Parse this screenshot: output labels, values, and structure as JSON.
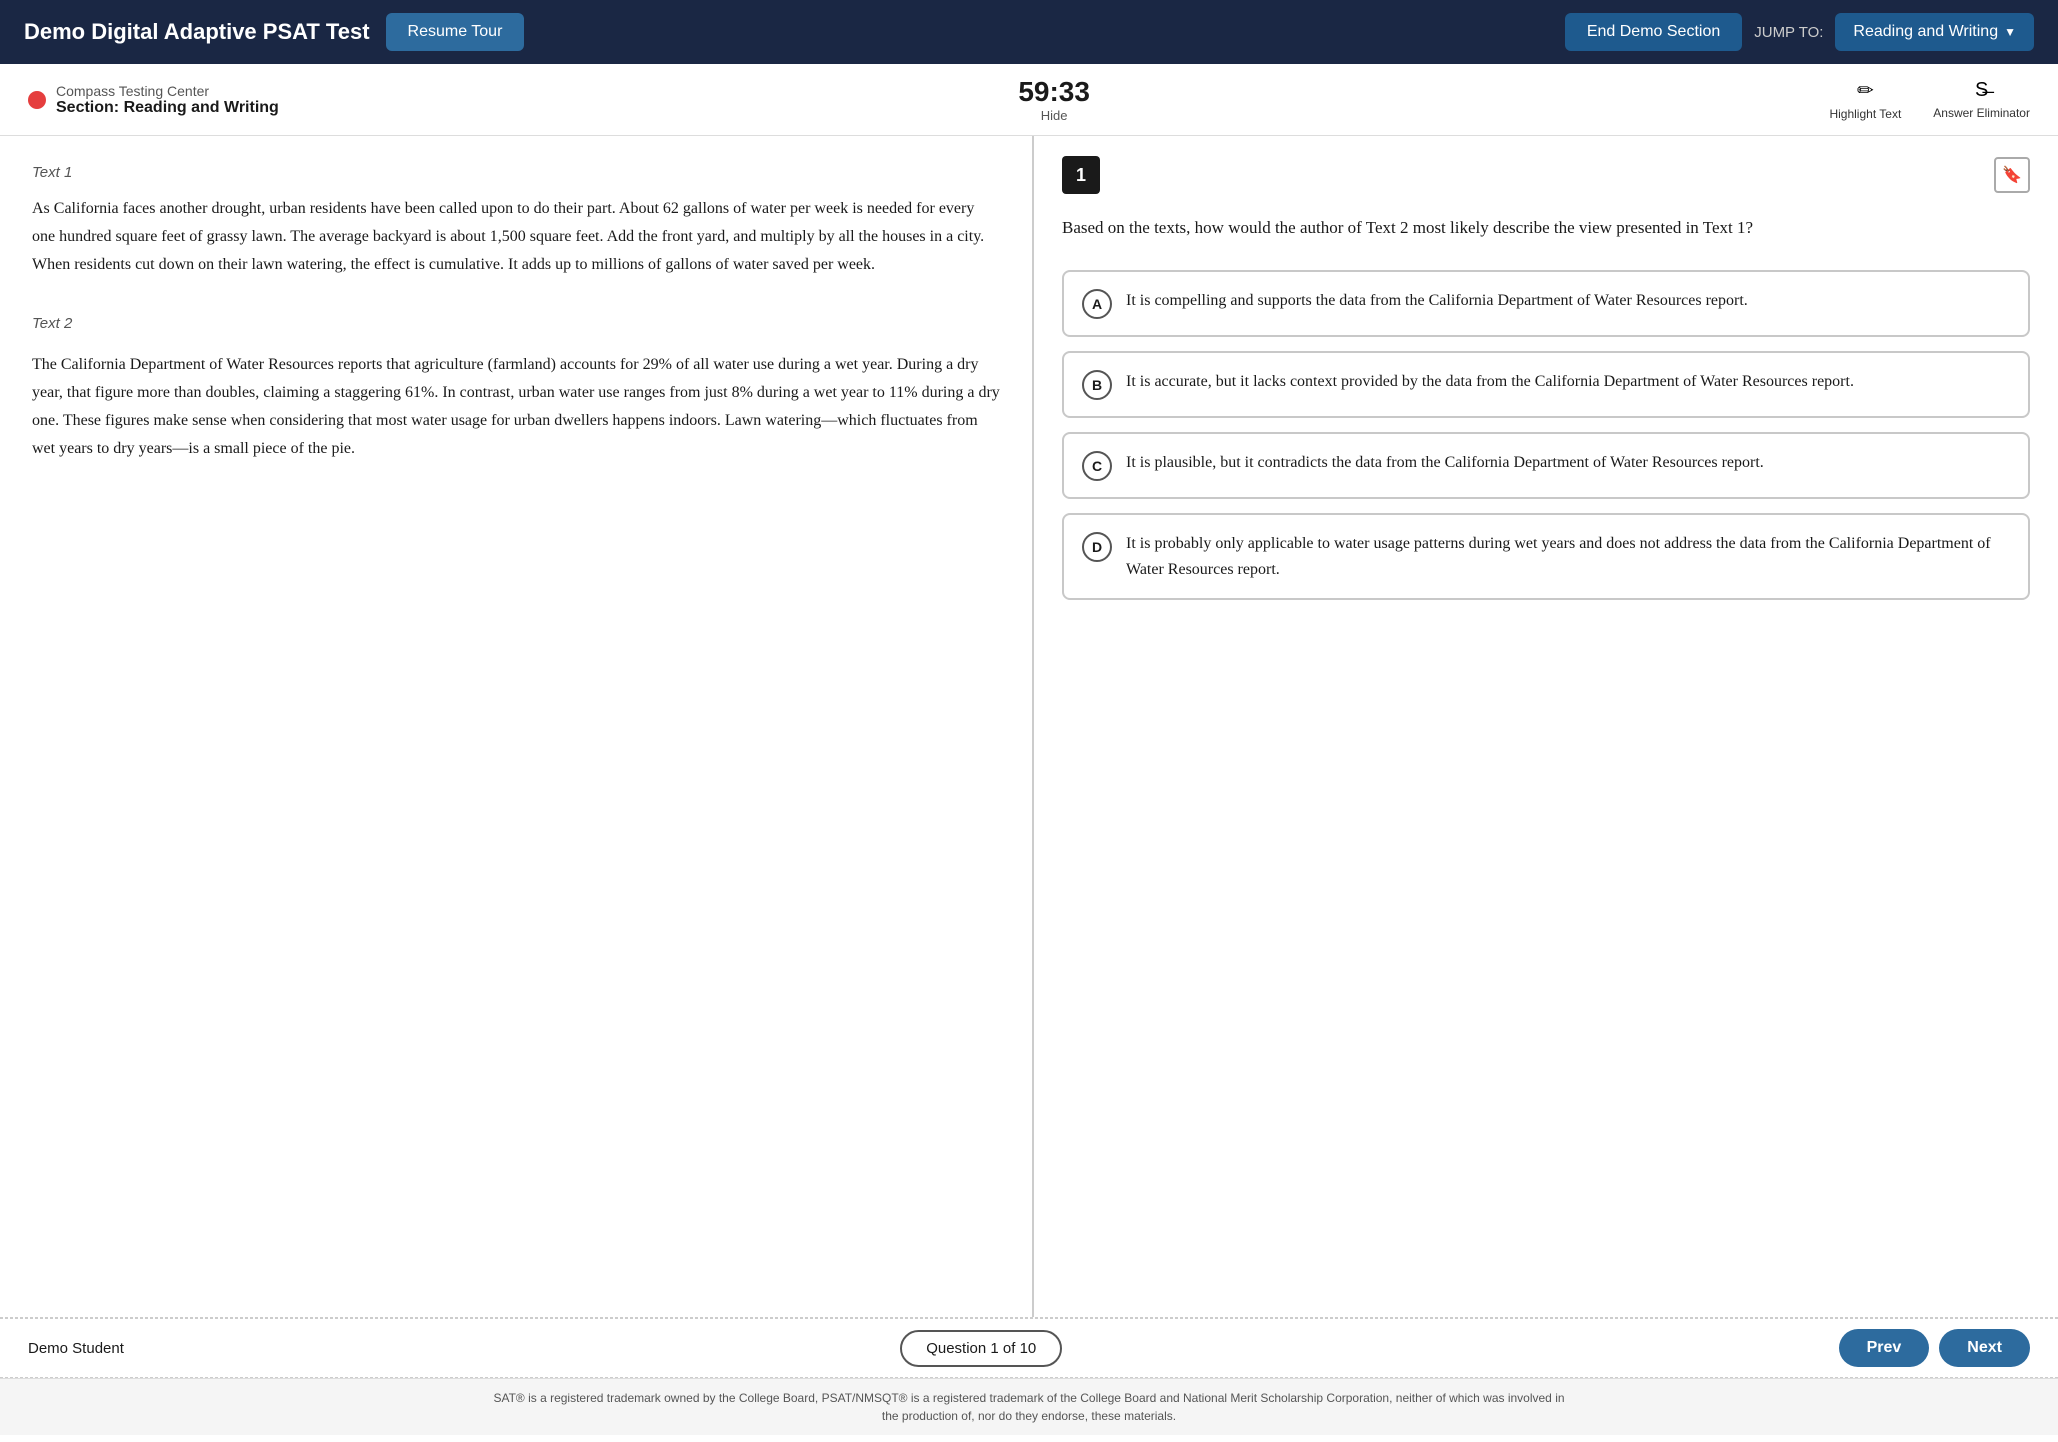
{
  "topNav": {
    "title": "Demo Digital Adaptive PSAT Test",
    "resumeTourLabel": "Resume Tour",
    "endDemoLabel": "End Demo Section",
    "jumpToLabel": "JUMP TO:",
    "jumpToValue": "Reading and Writing",
    "chevron": "▼"
  },
  "secHeader": {
    "orgName": "Compass Testing Center",
    "sectionLabel": "Section: Reading and Writing",
    "timer": "59:33",
    "hideLabel": "Hide",
    "highlightTextLabel": "Highlight Text",
    "answerEliminatorLabel": "Answer Eliminator",
    "highlightIcon": "✏",
    "eliminatorIcon": "S̶"
  },
  "passage": {
    "text1Label": "Text 1",
    "text1": "As California faces another drought, urban residents have been called upon to do their part. About 62 gallons of water per week is needed for every one hundred square feet of grassy lawn. The average backyard is about 1,500 square feet. Add the front yard, and multiply by all the houses in a city. When residents cut down on their lawn watering, the effect is cumulative. It adds up to millions of gallons of water saved per week.",
    "text2Label": "Text 2",
    "text2": "The California Department of Water Resources reports that agriculture (farmland) accounts for 29% of all water use during a wet year. During a dry year, that figure more than doubles, claiming a staggering 61%. In contrast, urban water use ranges from just 8% during a wet year to 11% during a dry one. These figures make sense when considering that most water usage for urban dwellers happens indoors. Lawn watering—which fluctuates from wet years to dry years—is a small piece of the pie."
  },
  "question": {
    "number": "1",
    "text": "Based on the texts, how would the author of Text 2 most likely describe the view presented in Text 1?",
    "choices": [
      {
        "letter": "A",
        "text": "It is compelling and supports the data from the California Department of Water Resources report."
      },
      {
        "letter": "B",
        "text": "It is accurate, but it lacks context provided by the data from the California Department of Water Resources report."
      },
      {
        "letter": "C",
        "text": "It is plausible, but it contradicts the data from the California Department of Water Resources report."
      },
      {
        "letter": "D",
        "text": "It is probably only applicable to water usage patterns during wet years and does not address the data from the California Department of Water Resources report."
      }
    ]
  },
  "bottomBar": {
    "studentName": "Demo Student",
    "questionCounter": "Question 1 of 10",
    "prevLabel": "Prev",
    "nextLabel": "Next"
  },
  "footer": {
    "text1": "SAT® is a registered trademark owned by the College Board, PSAT/NMSQT® is a registered trademark of the College Board and National Merit Scholarship Corporation, neither of which was involved in",
    "text2": "the production of, nor do they endorse, these materials."
  }
}
